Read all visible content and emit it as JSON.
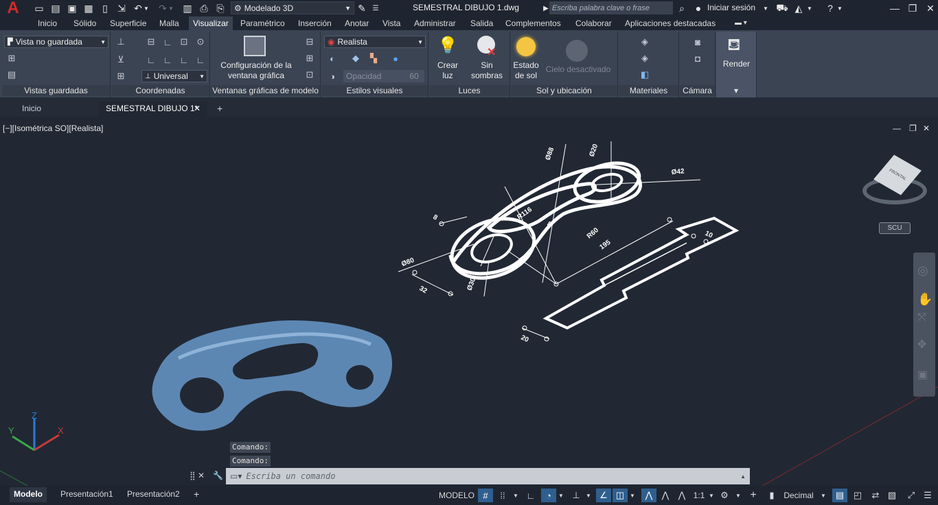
{
  "titlebar": {
    "workspace": "Modelado 3D",
    "document_title": "SEMESTRAL DIBUJO 1.dwg",
    "search_placeholder": "Escriba palabra clave o frase",
    "sign_in": "Iniciar sesión",
    "app_logo": "A"
  },
  "menu_tabs": [
    "Inicio",
    "Sólido",
    "Superficie",
    "Malla",
    "Visualizar",
    "Paramétrico",
    "Inserción",
    "Anotar",
    "Vista",
    "Administrar",
    "Salida",
    "Complementos",
    "Colaborar",
    "Aplicaciones destacadas"
  ],
  "active_menu_tab": "Visualizar",
  "ribbon": {
    "saved_view": "Vista no guardada",
    "ucs_select": "Universal",
    "visual_style": "Realista",
    "opacity_label": "Opacidad",
    "opacity_value": "60",
    "viewport_config_line1": "Configuración de la",
    "viewport_config_line2": "ventana gráfica",
    "create_light_line1": "Crear",
    "create_light_line2": "luz",
    "no_shadows_line1": "Sin",
    "no_shadows_line2": "sombras",
    "sun_state_line1": "Estado",
    "sun_state_line2": "de sol",
    "sky_off": "Cielo desactivado",
    "render": "Render",
    "panels": {
      "saved_views": "Vistas guardadas",
      "coordinates": "Coordenadas",
      "model_viewports": "Ventanas gráficas de modelo",
      "visual_styles": "Estilos visuales",
      "lights": "Luces",
      "sun_location": "Sol y ubicación",
      "materials": "Materiales",
      "camera": "Cámara"
    }
  },
  "doc_tabs": {
    "home": "Inicio",
    "active_doc": "SEMESTRAL DIBUJO 1*",
    "new_tab": "+"
  },
  "viewport": {
    "label": "[−][Isométrica SO][Realista]",
    "ucs_badge": "SCU",
    "viewcube_face": "FRONTAL"
  },
  "drawing_dims": {
    "d1": "Ø88",
    "d2": "Ø20",
    "d3": "Ø42",
    "d4": "R116",
    "d5": "R60",
    "d6": "195",
    "d7": "Ø80",
    "d8": "Ø30",
    "d9": "32",
    "d10": "8",
    "d11": "8",
    "d12": "10",
    "d13": "20"
  },
  "command": {
    "history1": "Comando:",
    "history2": "Comando:",
    "placeholder": "Escriba un comando"
  },
  "statusbar": {
    "tabs": [
      "Modelo",
      "Presentación1",
      "Presentación2"
    ],
    "model_label": "MODELO",
    "scale": "1:1",
    "units": "Decimal"
  },
  "colors": {
    "background": "#212833",
    "ribbon": "#3b4453",
    "solid_model": "#5d87b3",
    "logo_red": "#d42a2a"
  }
}
